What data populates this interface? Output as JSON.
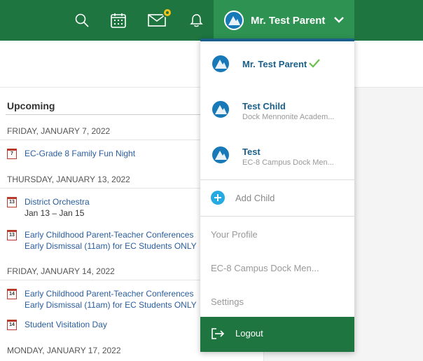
{
  "header": {
    "user_name": "Mr. Test Parent"
  },
  "feed": {
    "title": "Upcoming",
    "groups": [
      {
        "date": "FRIDAY, JANUARY 7, 2022",
        "events": [
          {
            "day": "7",
            "title": "EC-Grade 8 Family Fun Night"
          }
        ]
      },
      {
        "date": "THURSDAY, JANUARY 13, 2022",
        "events": [
          {
            "day": "13",
            "title": "District Orchestra",
            "sub": "Jan 13 – Jan 15"
          },
          {
            "day": "13",
            "title": "Early Childhood Parent-Teacher Conferences",
            "title2": "Early Dismissal (11am) for EC Students ONLY"
          }
        ]
      },
      {
        "date": "FRIDAY, JANUARY 14, 2022",
        "events": [
          {
            "day": "14",
            "title": "Early Childhood Parent-Teacher Conferences",
            "title2": "Early Dismissal (11am) for EC Students ONLY"
          },
          {
            "day": "14",
            "title": "Student Visitation Day"
          }
        ]
      },
      {
        "date": "MONDAY, JANUARY 17, 2022",
        "events": []
      }
    ]
  },
  "menu": {
    "accounts": [
      {
        "name": "Mr. Test Parent",
        "sub": ""
      },
      {
        "name": "Test Child",
        "sub": "Dock Mennonite Academ..."
      },
      {
        "name": "Test",
        "sub": "EC-8 Campus Dock Men..."
      }
    ],
    "add_child": "Add Child",
    "your_profile": "Your Profile",
    "school": "EC-8 Campus Dock Men...",
    "settings": "Settings",
    "logout": "Logout"
  },
  "icons": {
    "search": "search-icon",
    "calendar": "calendar-icon",
    "mail": "mail-icon",
    "bell": "bell-icon",
    "chevron": "chevron-down-icon",
    "check": "check-icon",
    "plus": "plus-circle-icon",
    "logout": "logout-icon"
  },
  "colors": {
    "header": "#1e7540",
    "user_button": "#2e9252",
    "badge": "#f2c21b",
    "link": "#2a5d9e",
    "check": "#6cc04a",
    "add_child_icon": "#27a9e1"
  }
}
